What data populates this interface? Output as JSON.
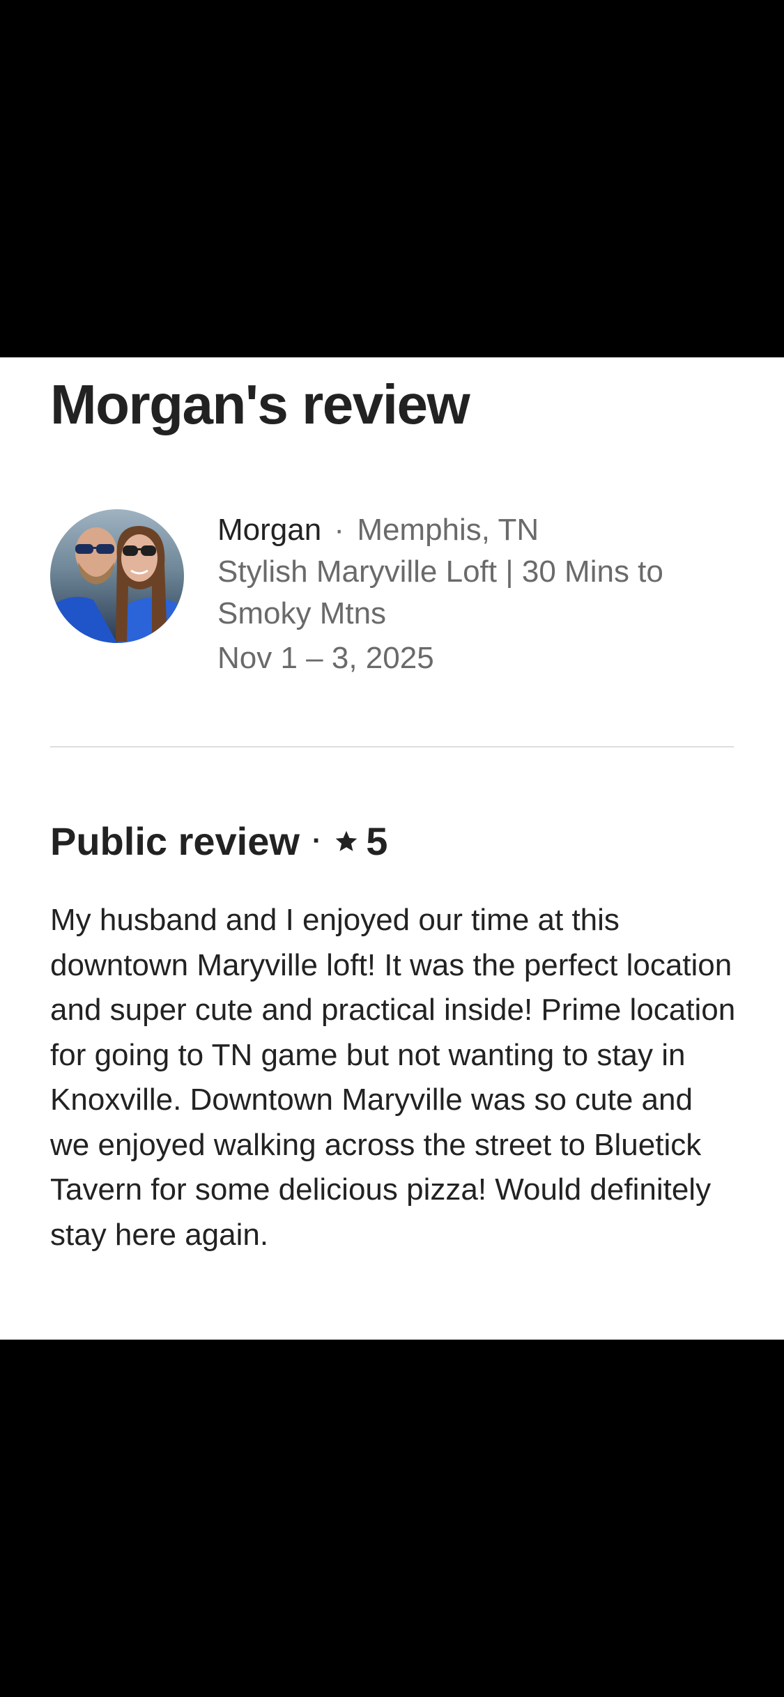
{
  "page": {
    "title": "Morgan's review"
  },
  "reviewer": {
    "name": "Morgan",
    "separator": "·",
    "location": "Memphis, TN",
    "listing": "Stylish Maryville Loft | 30 Mins to Smoky Mtns",
    "dates": "Nov 1 – 3, 2025",
    "avatar_icon": "couple-photo-avatar"
  },
  "public_review": {
    "heading": "Public review",
    "separator": "·",
    "rating": "5",
    "rating_icon": "star-icon",
    "body": "My husband and I enjoyed our time at this downtown Maryville loft! It was the perfect location and super cute and practical inside! Prime location for going to TN game but not wanting to stay in Knoxville. Downtown Maryville was so cute and we enjoyed walking across the street to Bluetick Tavern for some delicious pizza! Would definitely stay here again."
  },
  "colors": {
    "text_primary": "#222222",
    "text_secondary": "#6a6a6a",
    "divider": "#dddddd",
    "background": "#ffffff"
  }
}
